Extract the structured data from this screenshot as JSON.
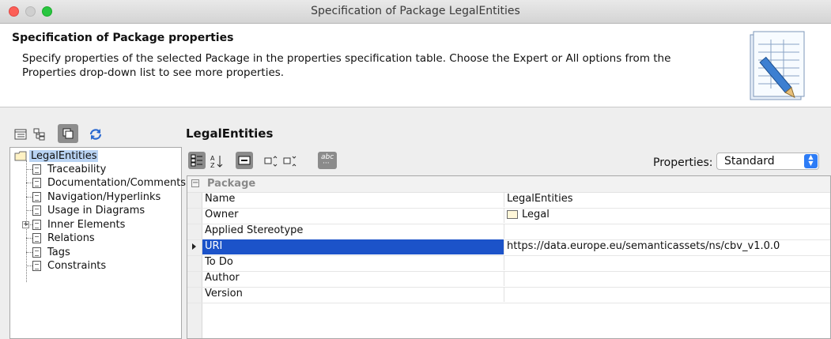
{
  "window": {
    "title": "Specification of Package LegalEntities"
  },
  "header": {
    "title": "Specification of Package properties",
    "description": "Specify properties of the selected Package in the properties specification table. Choose the Expert or All options from the Properties drop-down list to see more properties."
  },
  "tree": {
    "root": "LegalEntities",
    "items": [
      {
        "label": "Traceability"
      },
      {
        "label": "Documentation/Comments"
      },
      {
        "label": "Navigation/Hyperlinks"
      },
      {
        "label": "Usage in Diagrams"
      },
      {
        "label": "Inner Elements"
      },
      {
        "label": "Relations"
      },
      {
        "label": "Tags"
      },
      {
        "label": "Constraints"
      }
    ]
  },
  "panel": {
    "title": "LegalEntities",
    "properties_label": "Properties:",
    "properties_value": "Standard",
    "abc_label": "abc"
  },
  "grid": {
    "category": "Package",
    "rows": [
      {
        "name": "Name",
        "value": "LegalEntities"
      },
      {
        "name": "Owner",
        "value": "Legal"
      },
      {
        "name": "Applied Stereotype",
        "value": ""
      },
      {
        "name": "URI",
        "value": "https://data.europe.eu/semanticassets/ns/cbv_v1.0.0"
      },
      {
        "name": "To Do",
        "value": ""
      },
      {
        "name": "Author",
        "value": ""
      },
      {
        "name": "Version",
        "value": ""
      }
    ]
  },
  "colors": {
    "selection": "#1c53c9",
    "tree_selection": "#b9d3f3",
    "accent": "#2d7cf6"
  }
}
